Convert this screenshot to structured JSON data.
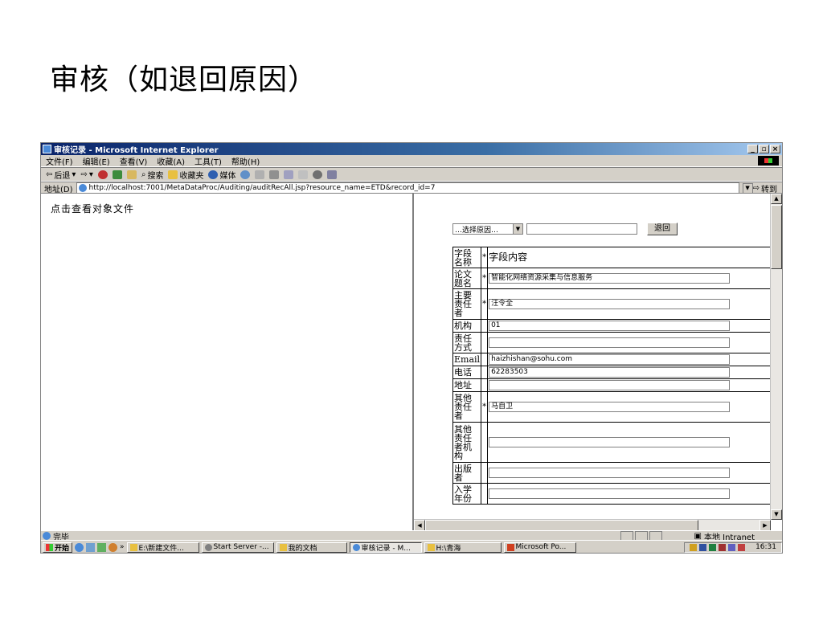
{
  "slide": {
    "title": "审核（如退回原因）"
  },
  "window": {
    "title": "审核记录 - Microsoft Internet Explorer",
    "controls": [
      "_",
      "▫",
      "×"
    ]
  },
  "menu": [
    "文件(F)",
    "编辑(E)",
    "查看(V)",
    "收藏(A)",
    "工具(T)",
    "帮助(H)"
  ],
  "toolbar": {
    "back": "后退",
    "search": "搜索",
    "favorites": "收藏夹",
    "media": "媒体"
  },
  "address": {
    "label": "地址(D)",
    "url": "http://localhost:7001/MetaDataProc/Auditing/auditRecAll.jsp?resource_name=ETD&record_id=7",
    "go": "转到"
  },
  "left_frame": {
    "link": "点击查看对象文件"
  },
  "right_frame": {
    "reason_select": "…选择原因…",
    "back_button": "退回",
    "header": {
      "label": "字段名称",
      "star": "*",
      "value": "字段内容"
    },
    "fields": [
      {
        "label": "论文题名",
        "star": "*",
        "value": "智能化网络资源采集与信息服务"
      },
      {
        "label": "主要责任者",
        "star": "*",
        "value": "汪令全"
      },
      {
        "label": "机构",
        "star": "",
        "value": "01"
      },
      {
        "label": "责任方式",
        "star": "",
        "value": ""
      },
      {
        "label": "Email",
        "star": "",
        "value": "haizhishan@sohu.com"
      },
      {
        "label": "电话",
        "star": "",
        "value": "62283503"
      },
      {
        "label": "地址",
        "star": "",
        "value": ""
      },
      {
        "label": "其他责任者",
        "star": "*",
        "value": "马自卫"
      },
      {
        "label": "其他责任者机构",
        "star": "",
        "value": ""
      },
      {
        "label": "出版者",
        "star": "",
        "value": ""
      },
      {
        "label": "入学年份",
        "star": "",
        "value": ""
      }
    ]
  },
  "status": {
    "text": "完毕",
    "zone": "本地 Intranet"
  },
  "taskbar": {
    "start": "开始",
    "quick_more": "»",
    "items": [
      {
        "label": "E:\\新建文件...",
        "active": false
      },
      {
        "label": "Start Server -...",
        "active": false
      },
      {
        "label": "我的文档",
        "active": false
      },
      {
        "label": "审核记录 - M...",
        "active": true
      },
      {
        "label": "H:\\青海",
        "active": false
      },
      {
        "label": "Microsoft Po...",
        "active": false
      }
    ],
    "clock": "16:31"
  },
  "colors": {
    "titlebar": "#0a246a",
    "chrome": "#d4d0c8"
  }
}
